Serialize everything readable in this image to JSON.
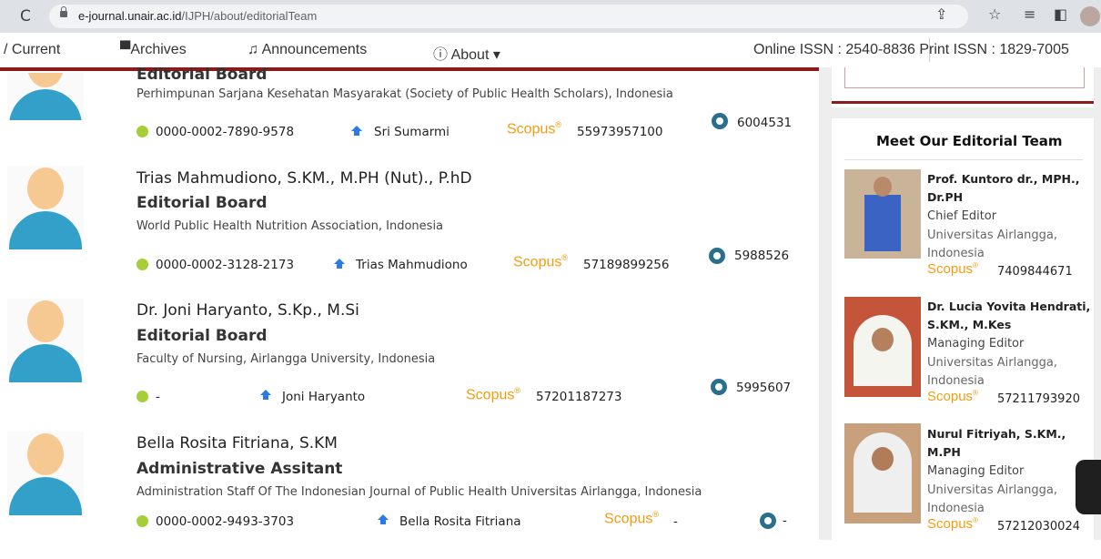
{
  "browser": {
    "url_host": "e-journal.unair.ac.id",
    "url_path": "/IJPH/about/editorialTeam"
  },
  "nav": {
    "current": "Current",
    "archives": "Archives",
    "announcements": "Announcements",
    "about": "About",
    "issn": "Online ISSN : 2540-8836  Print ISSN : 1829-7005"
  },
  "entries": [
    {
      "name": "",
      "role": "Editorial Board",
      "affiliation": "Perhimpunan Sarjana Kesehatan Masyarakat (Society of Public Health Scholars), Indonesia",
      "orcid": "0000-0002-7890-9578",
      "sinta_name": "Sri Sumarmi",
      "scopus_label": "Scopus",
      "scopus_id": "55973957100",
      "gs_id": "6004531"
    },
    {
      "name": "Trias Mahmudiono, S.KM., M.PH (Nut)., P.hD",
      "role": "Editorial Board",
      "affiliation": "World Public Health Nutrition Association, Indonesia",
      "orcid": "0000-0002-3128-2173",
      "sinta_name": "Trias Mahmudiono",
      "scopus_label": "Scopus",
      "scopus_id": "57189899256",
      "gs_id": "5988526"
    },
    {
      "name": "Dr. Joni Haryanto, S.Kp., M.Si",
      "role": "Editorial Board",
      "affiliation": "Faculty of Nursing, Airlangga University, Indonesia",
      "orcid": "-",
      "sinta_name": "Joni Haryanto",
      "scopus_label": "Scopus",
      "scopus_id": "57201187273",
      "gs_id": "5995607"
    },
    {
      "name": "Bella Rosita Fitriana, S.KM",
      "role": "Administrative Assitant",
      "affiliation": "Administration Staff Of The Indonesian Journal of Public Health Universitas Airlangga, Indonesia",
      "orcid": "0000-0002-9493-3703",
      "sinta_name": "Bella Rosita Fitriana",
      "scopus_label": "Scopus",
      "scopus_id": "-",
      "gs_id": "-"
    }
  ],
  "sidebar": {
    "title": "Meet Our Editorial Team",
    "members": [
      {
        "name": "Prof. Kuntoro dr., MPH., Dr.PH",
        "role": "Chief Editor",
        "affiliation": "Universitas Airlangga, Indonesia",
        "scopus_label": "Scopus",
        "scopus_id": "7409844671"
      },
      {
        "name": "Dr. Lucia Yovita Hendrati, S.KM., M.Kes",
        "role": "Managing Editor",
        "affiliation": "Universitas Airlangga, Indonesia",
        "scopus_label": "Scopus",
        "scopus_id": "57211793920"
      },
      {
        "name": "Nurul Fitriyah, S.KM., M.PH",
        "role": "Managing Editor",
        "affiliation": "Universitas Airlangga, Indonesia",
        "scopus_label": "Scopus",
        "scopus_id": "57212030024"
      }
    ]
  }
}
